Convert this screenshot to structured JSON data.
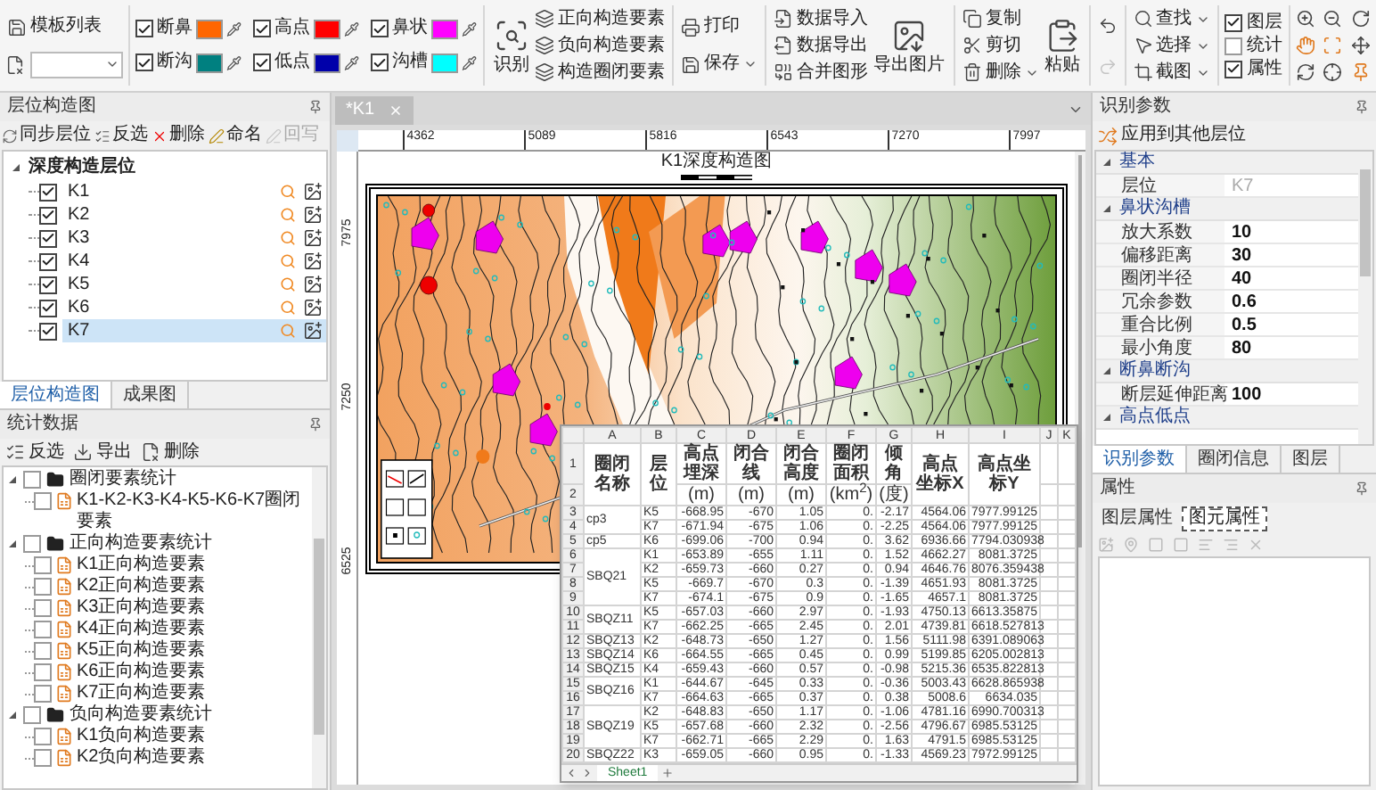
{
  "toolbar": {
    "template": {
      "label": "模板列表"
    },
    "color_options": [
      {
        "label": "断鼻",
        "checked": true,
        "color": "#ff6600"
      },
      {
        "label": "高点",
        "checked": true,
        "color": "#ff0000"
      },
      {
        "label": "鼻状",
        "checked": true,
        "color": "#ff00ff"
      },
      {
        "label": "断沟",
        "checked": true,
        "color": "#008080"
      },
      {
        "label": "低点",
        "checked": true,
        "color": "#0000aa"
      },
      {
        "label": "沟槽",
        "checked": true,
        "color": "#00ffff"
      }
    ],
    "recognize": {
      "label": "识别"
    },
    "element_buttons": [
      "正向构造要素",
      "负向构造要素",
      "构造圈闭要素"
    ],
    "file_buttons": [
      {
        "label": "打印",
        "dropdown": false
      },
      {
        "label": "保存",
        "dropdown": true
      }
    ],
    "data_buttons": [
      "数据导入",
      "数据导出",
      "合并图形"
    ],
    "export_image": {
      "label": "导出图片"
    },
    "edit_buttons": [
      {
        "label": "复制",
        "dropdown": false
      },
      {
        "label": "剪切",
        "dropdown": false
      },
      {
        "label": "删除",
        "dropdown": true
      }
    ],
    "paste": {
      "label": "粘贴"
    },
    "history": [
      {
        "kind": "undo",
        "disabled": false
      },
      {
        "kind": "redo",
        "disabled": true
      }
    ],
    "select_buttons": [
      {
        "label": "查找",
        "dropdown": true
      },
      {
        "label": "选择",
        "dropdown": true
      },
      {
        "label": "截图",
        "dropdown": true
      }
    ],
    "view_toggles": [
      {
        "label": "图层",
        "checked": true
      },
      {
        "label": "统计",
        "checked": false
      },
      {
        "label": "属性",
        "checked": true
      }
    ]
  },
  "layer_panel": {
    "title": "层位构造图",
    "tools": [
      {
        "kind": "sync",
        "label": "同步层位",
        "disabled": false
      },
      {
        "kind": "invert",
        "label": "反选",
        "disabled": false
      },
      {
        "kind": "delete",
        "label": "删除",
        "disabled": false
      },
      {
        "kind": "rename",
        "label": "命名",
        "disabled": false
      },
      {
        "kind": "writeback",
        "label": "回写",
        "disabled": true
      }
    ],
    "tree": {
      "label": "深度构造层位",
      "expanded": true,
      "children": [
        {
          "label": "K1",
          "checked": true,
          "selected": false
        },
        {
          "label": "K2",
          "checked": true,
          "selected": false
        },
        {
          "label": "K3",
          "checked": true,
          "selected": false
        },
        {
          "label": "K4",
          "checked": true,
          "selected": false
        },
        {
          "label": "K5",
          "checked": true,
          "selected": false
        },
        {
          "label": "K6",
          "checked": true,
          "selected": false
        },
        {
          "label": "K7",
          "checked": true,
          "selected": true
        }
      ]
    }
  },
  "left_tabs": [
    {
      "label": "层位构造图",
      "selected": true
    },
    {
      "label": "成果图",
      "selected": false
    }
  ],
  "stats_panel": {
    "title": "统计数据",
    "tools": [
      "反选",
      "导出",
      "删除"
    ],
    "tree": [
      {
        "label": "圈闭要素统计",
        "checked": false,
        "expanded": true,
        "children": [
          {
            "label": "K1-K2-K3-K4-K5-K6-K7圈闭要素",
            "checked": false
          }
        ]
      },
      {
        "label": "正向构造要素统计",
        "checked": false,
        "expanded": true,
        "children": [
          {
            "label": "K1正向构造要素",
            "checked": false
          },
          {
            "label": "K2正向构造要素",
            "checked": false
          },
          {
            "label": "K3正向构造要素",
            "checked": false
          },
          {
            "label": "K4正向构造要素",
            "checked": false
          },
          {
            "label": "K5正向构造要素",
            "checked": false
          },
          {
            "label": "K6正向构造要素",
            "checked": false
          },
          {
            "label": "K7正向构造要素",
            "checked": false
          }
        ]
      },
      {
        "label": "负向构造要素统计",
        "checked": false,
        "expanded": true,
        "children": [
          {
            "label": "K1负向构造要素",
            "checked": false
          },
          {
            "label": "K2负向构造要素",
            "checked": false
          }
        ]
      }
    ]
  },
  "document_tabs": [
    {
      "label": "*K1",
      "selected": true
    }
  ],
  "map": {
    "x_ticks": [
      "4362",
      "5089",
      "5816",
      "6543",
      "7270",
      "7997"
    ],
    "y_ticks": [
      "7975",
      "7250",
      "6525"
    ],
    "title": "K1深度构造图"
  },
  "spreadsheet": {
    "column_letters": [
      "A",
      "B",
      "C",
      "D",
      "E",
      "F",
      "G",
      "H",
      "I",
      "J",
      "K"
    ],
    "row_numbers": [
      "1",
      "2",
      "3",
      "4",
      "5",
      "6",
      "7",
      "8",
      "9",
      "10",
      "11",
      "12",
      "13",
      "14",
      "15",
      "16",
      "17",
      "18",
      "19",
      "20"
    ],
    "headers": [
      {
        "label": "圈闭名称"
      },
      {
        "label": "层位"
      },
      {
        "label": "高点埋深",
        "unit": "(m)"
      },
      {
        "label": "闭合线",
        "unit": "(m)"
      },
      {
        "label": "闭合高度",
        "unit": "(m)"
      },
      {
        "label": "圈闭面积",
        "unit": "(km$^{2}$)"
      },
      {
        "label": "倾角",
        "unit": "(度)"
      },
      {
        "label": "高点坐标X"
      },
      {
        "label": "高点坐标Y"
      }
    ],
    "groups": [
      {
        "name": "cp3",
        "rows": [
          [
            "K5",
            "-668.95",
            "-670",
            "1.05",
            "0.",
            "-2.17",
            "4564.06",
            "7977.99125"
          ],
          [
            "K7",
            "-671.94",
            "-675",
            "1.06",
            "0.",
            "-2.25",
            "4564.06",
            "7977.99125"
          ]
        ]
      },
      {
        "name": "cp5",
        "rows": [
          [
            "K6",
            "-699.06",
            "-700",
            "0.94",
            "0.",
            "3.62",
            "6936.66",
            "7794.030938"
          ]
        ]
      },
      {
        "name": "SBQ21",
        "rows": [
          [
            "K1",
            "-653.89",
            "-655",
            "1.11",
            "0.",
            "1.52",
            "4662.27",
            "8081.3725"
          ],
          [
            "K2",
            "-659.73",
            "-660",
            "0.27",
            "0.",
            "0.94",
            "4646.76",
            "8076.359438"
          ],
          [
            "K5",
            "-669.7",
            "-670",
            "0.3",
            "0.",
            "-1.39",
            "4651.93",
            "8081.3725"
          ],
          [
            "K7",
            "-674.1",
            "-675",
            "0.9",
            "0.",
            "-1.65",
            "4657.1",
            "8081.3725"
          ]
        ]
      },
      {
        "name": "SBQZ11",
        "rows": [
          [
            "K5",
            "-657.03",
            "-660",
            "2.97",
            "0.",
            "-1.93",
            "4750.13",
            "6613.35875"
          ],
          [
            "K7",
            "-662.25",
            "-665",
            "2.45",
            "0.",
            "2.01",
            "4739.81",
            "6618.527813"
          ]
        ]
      },
      {
        "name": "SBQZ13",
        "rows": [
          [
            "K2",
            "-648.73",
            "-650",
            "1.27",
            "0.",
            "1.56",
            "5111.98",
            "6391.089063"
          ]
        ]
      },
      {
        "name": "SBQZ14",
        "rows": [
          [
            "K6",
            "-664.55",
            "-665",
            "0.45",
            "0.",
            "0.99",
            "5199.85",
            "6205.002813"
          ]
        ]
      },
      {
        "name": "SBQZ15",
        "rows": [
          [
            "K4",
            "-659.43",
            "-660",
            "0.57",
            "0.",
            "-0.98",
            "5215.36",
            "6535.822813"
          ]
        ]
      },
      {
        "name": "SBQZ16",
        "rows": [
          [
            "K1",
            "-644.67",
            "-645",
            "0.33",
            "0.",
            "-0.36",
            "5003.43",
            "6628.865938"
          ],
          [
            "K7",
            "-664.63",
            "-665",
            "0.37",
            "0.",
            "0.38",
            "5008.6",
            "6634.035"
          ]
        ]
      },
      {
        "name": "SBQZ19",
        "rows": [
          [
            "K2",
            "-648.83",
            "-650",
            "1.17",
            "0.",
            "-1.06",
            "4781.16",
            "6990.700313"
          ],
          [
            "K5",
            "-657.68",
            "-660",
            "2.32",
            "0.",
            "-2.56",
            "4796.67",
            "6985.53125"
          ],
          [
            "K7",
            "-662.71",
            "-665",
            "2.29",
            "0.",
            "1.63",
            "4791.5",
            "6985.53125"
          ]
        ]
      },
      {
        "name": "SBQZ22",
        "rows": [
          [
            "K3",
            "-659.05",
            "-660",
            "0.95",
            "0.",
            "-1.33",
            "4569.23",
            "7972.99125"
          ]
        ]
      }
    ],
    "sheet_tabs": [
      {
        "label": "Sheet1",
        "selected": true
      }
    ]
  },
  "params_panel": {
    "title": "识别参数",
    "apply_button": "应用到其他层位",
    "categories": [
      {
        "label": "基本",
        "expanded": true,
        "rows": [
          {
            "label": "层位",
            "value": "K7",
            "disabled": true
          }
        ]
      },
      {
        "label": "鼻状沟槽",
        "expanded": true,
        "rows": [
          {
            "label": "放大系数",
            "value": "10",
            "disabled": false
          },
          {
            "label": "偏移距离",
            "value": "30",
            "disabled": false
          },
          {
            "label": "圈闭半径",
            "value": "40",
            "disabled": false
          },
          {
            "label": "冗余参数",
            "value": "0.6",
            "disabled": false
          },
          {
            "label": "重合比例",
            "value": "0.5",
            "disabled": false
          },
          {
            "label": "最小角度",
            "value": "80",
            "disabled": false
          }
        ]
      },
      {
        "label": "断鼻断沟",
        "expanded": true,
        "rows": [
          {
            "label": "断层延伸距离",
            "value": "100",
            "disabled": false
          }
        ]
      },
      {
        "label": "高点低点",
        "expanded": true
      }
    ]
  },
  "right_tabs": [
    {
      "label": "识别参数",
      "selected": true
    },
    {
      "label": "圈闭信息",
      "selected": false
    },
    {
      "label": "图层",
      "selected": false
    }
  ],
  "properties_panel": {
    "title": "属性",
    "tabs": [
      {
        "label": "图层属性",
        "selected": false
      },
      {
        "label": "图元属性",
        "selected": true
      }
    ]
  }
}
